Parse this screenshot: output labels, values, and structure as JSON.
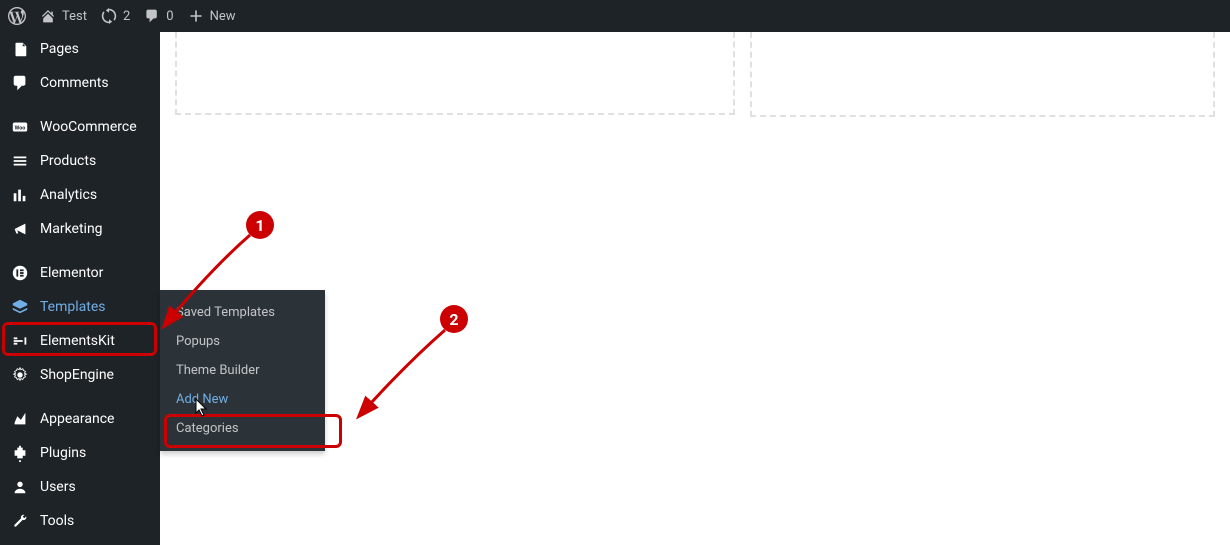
{
  "adminBar": {
    "siteName": "Test",
    "refreshCount": "2",
    "commentCount": "0",
    "newLabel": "New"
  },
  "sidebar": {
    "items": [
      {
        "label": "Pages",
        "icon": "page-icon"
      },
      {
        "label": "Comments",
        "icon": "comments-icon"
      },
      {
        "label": "WooCommerce",
        "icon": "woo-icon"
      },
      {
        "label": "Products",
        "icon": "products-icon"
      },
      {
        "label": "Analytics",
        "icon": "analytics-icon"
      },
      {
        "label": "Marketing",
        "icon": "marketing-icon"
      },
      {
        "label": "Elementor",
        "icon": "elementor-icon"
      },
      {
        "label": "Templates",
        "icon": "templates-icon",
        "active": true
      },
      {
        "label": "ElementsKit",
        "icon": "elementskit-icon"
      },
      {
        "label": "ShopEngine",
        "icon": "shopengine-icon"
      },
      {
        "label": "Appearance",
        "icon": "appearance-icon"
      },
      {
        "label": "Plugins",
        "icon": "plugins-icon"
      },
      {
        "label": "Users",
        "icon": "users-icon"
      },
      {
        "label": "Tools",
        "icon": "tools-icon"
      }
    ]
  },
  "submenu": {
    "items": [
      {
        "label": "Saved Templates"
      },
      {
        "label": "Popups"
      },
      {
        "label": "Theme Builder"
      },
      {
        "label": "Add New",
        "active": true
      },
      {
        "label": "Categories"
      }
    ]
  },
  "annotations": {
    "badge1": "1",
    "badge2": "2"
  }
}
